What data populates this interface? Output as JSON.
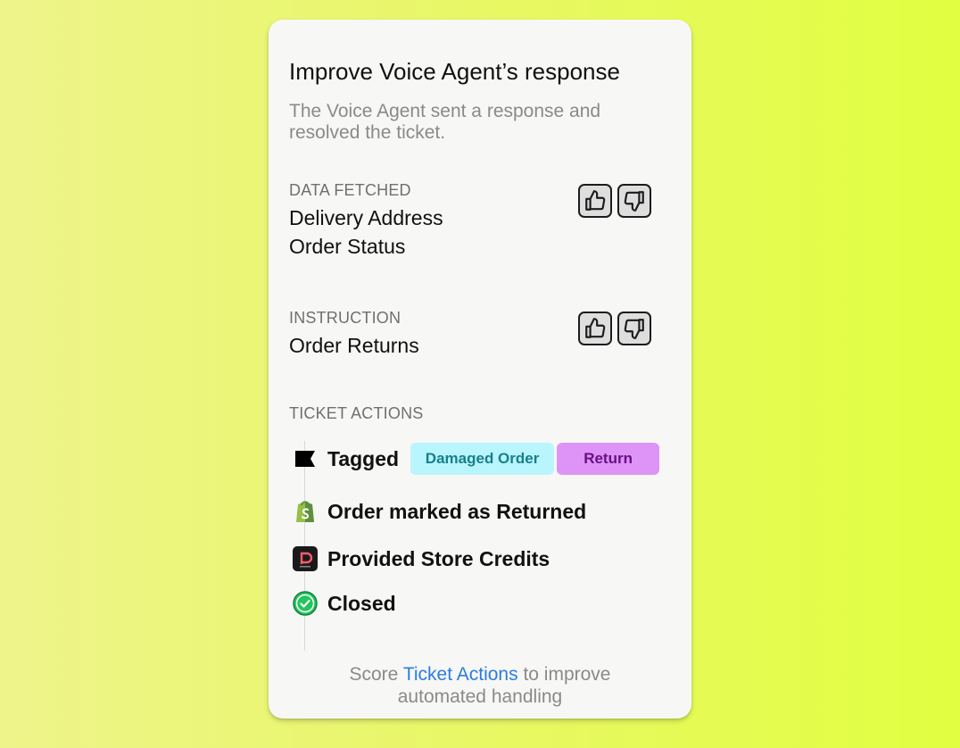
{
  "card": {
    "title": "Improve Voice Agent’s response",
    "subtitle_lines": [
      "The Voice Agent sent a response and",
      "resolved the ticket."
    ]
  },
  "data_fetched": {
    "label": "DATA FETCHED",
    "items": [
      "Delivery Address",
      "Order Status"
    ]
  },
  "instruction": {
    "label": "INSTRUCTION",
    "items": [
      "Order Returns"
    ]
  },
  "ticket_actions": {
    "label": "TICKET ACTIONS",
    "actions": [
      {
        "icon": "flag-icon",
        "text": "Tagged",
        "tags": [
          "Damaged Order",
          "Return"
        ]
      },
      {
        "icon": "shopify-icon",
        "text": "Order marked as Returned"
      },
      {
        "icon": "store-credit-app-icon",
        "text": "Provided Store Credits"
      },
      {
        "icon": "check-circle-icon",
        "text": "Closed"
      }
    ]
  },
  "footer": {
    "prefix": "Score ",
    "link": "Ticket Actions",
    "suffix": " to improve",
    "line2": "automated handling"
  },
  "colors": {
    "accent_link": "#2a7de1",
    "tag_damaged_bg": "#b9f5fc",
    "tag_return_bg": "#de94f7",
    "closed_green": "#22c55e"
  }
}
